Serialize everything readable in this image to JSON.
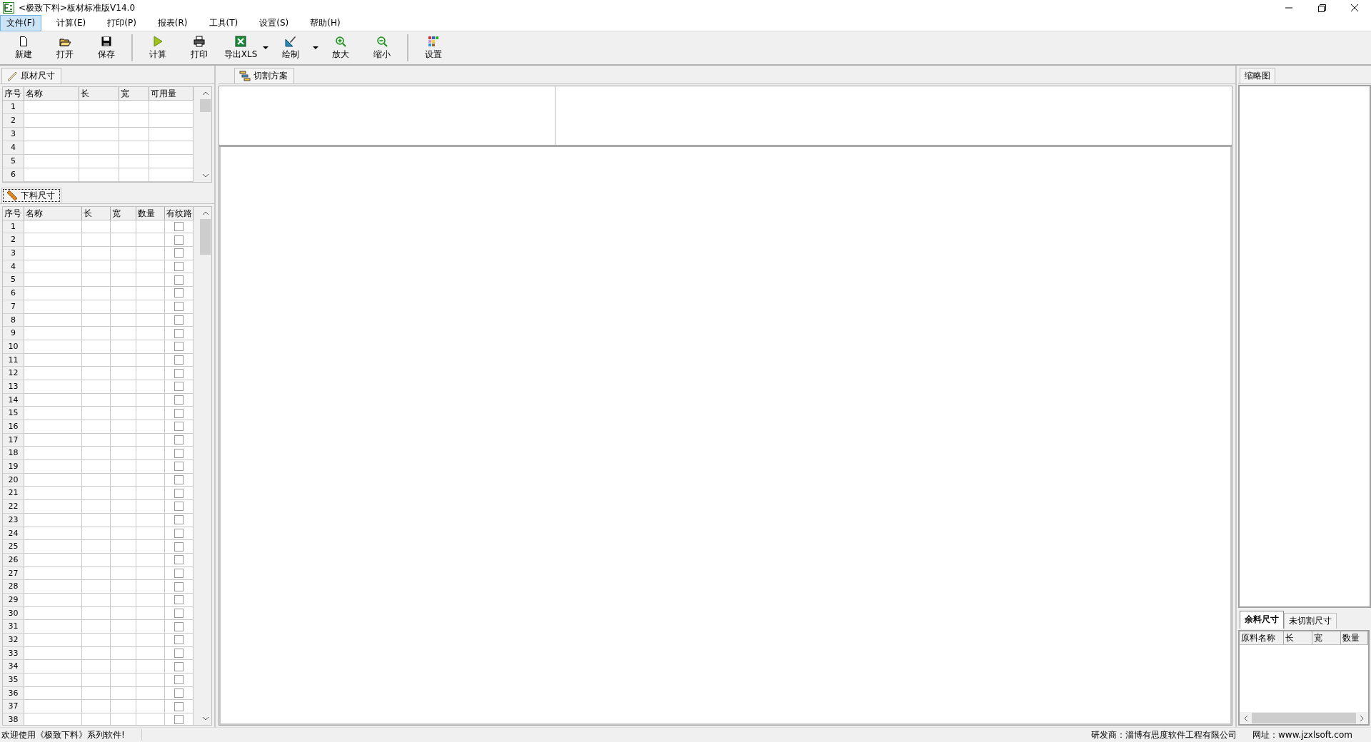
{
  "window": {
    "title": "<极致下料>板材标准版V14.0"
  },
  "menu": [
    {
      "label": "文件(F)",
      "selected": true
    },
    {
      "label": "计算(E)",
      "selected": false
    },
    {
      "label": "打印(P)",
      "selected": false
    },
    {
      "label": "报表(R)",
      "selected": false
    },
    {
      "label": "工具(T)",
      "selected": false
    },
    {
      "label": "设置(S)",
      "selected": false
    },
    {
      "label": "帮助(H)",
      "selected": false
    }
  ],
  "toolbar": {
    "groups": [
      [
        {
          "label": "新建",
          "dropdown": false
        },
        {
          "label": "打开",
          "dropdown": false
        },
        {
          "label": "保存",
          "dropdown": false
        }
      ],
      [
        {
          "label": "计算",
          "dropdown": false
        },
        {
          "label": "打印",
          "dropdown": false
        },
        {
          "label": "导出XLS",
          "dropdown": true
        },
        {
          "label": "绘制",
          "dropdown": true
        },
        {
          "label": "放大",
          "dropdown": false
        },
        {
          "label": "缩小",
          "dropdown": false
        }
      ],
      [
        {
          "label": "设置",
          "dropdown": false
        }
      ]
    ]
  },
  "raw_panel": {
    "tab": "原材尺寸",
    "columns": [
      "序号",
      "名称",
      "长",
      "宽",
      "可用量"
    ],
    "rows": [
      {
        "no": "1"
      },
      {
        "no": "2"
      },
      {
        "no": "3"
      },
      {
        "no": "4"
      },
      {
        "no": "5"
      },
      {
        "no": "6"
      }
    ]
  },
  "cut_panel": {
    "tab": "下料尺寸",
    "columns": [
      "序号",
      "名称",
      "长",
      "宽",
      "数量",
      "有纹路"
    ],
    "rows": [
      {
        "no": "1",
        "has_grain": false
      },
      {
        "no": "2",
        "has_grain": false
      },
      {
        "no": "3",
        "has_grain": false
      },
      {
        "no": "4",
        "has_grain": false
      },
      {
        "no": "5",
        "has_grain": false
      },
      {
        "no": "6",
        "has_grain": false
      },
      {
        "no": "7",
        "has_grain": false
      },
      {
        "no": "8",
        "has_grain": false
      },
      {
        "no": "9",
        "has_grain": false
      },
      {
        "no": "10",
        "has_grain": false
      },
      {
        "no": "11",
        "has_grain": false
      },
      {
        "no": "12",
        "has_grain": false
      },
      {
        "no": "13",
        "has_grain": false
      },
      {
        "no": "14",
        "has_grain": false
      },
      {
        "no": "15",
        "has_grain": false
      },
      {
        "no": "16",
        "has_grain": false
      },
      {
        "no": "17",
        "has_grain": false
      },
      {
        "no": "18",
        "has_grain": false
      },
      {
        "no": "19",
        "has_grain": false
      },
      {
        "no": "20",
        "has_grain": false
      },
      {
        "no": "21",
        "has_grain": false
      },
      {
        "no": "22",
        "has_grain": false
      },
      {
        "no": "23",
        "has_grain": false
      },
      {
        "no": "24",
        "has_grain": false
      },
      {
        "no": "25",
        "has_grain": false
      },
      {
        "no": "26",
        "has_grain": false
      },
      {
        "no": "27",
        "has_grain": false
      },
      {
        "no": "28",
        "has_grain": false
      },
      {
        "no": "29",
        "has_grain": false
      },
      {
        "no": "30",
        "has_grain": false
      },
      {
        "no": "31",
        "has_grain": false
      },
      {
        "no": "32",
        "has_grain": false
      },
      {
        "no": "33",
        "has_grain": false
      },
      {
        "no": "34",
        "has_grain": false
      },
      {
        "no": "35",
        "has_grain": false
      },
      {
        "no": "36",
        "has_grain": false
      },
      {
        "no": "37",
        "has_grain": false
      },
      {
        "no": "38",
        "has_grain": false
      }
    ]
  },
  "plan_panel": {
    "tab": "切割方案"
  },
  "thumbnail_panel": {
    "tab": "缩略图"
  },
  "remnant_panel": {
    "tabs": [
      {
        "label": "余料尺寸",
        "selected": true
      },
      {
        "label": "未切割尺寸",
        "selected": false
      }
    ],
    "columns": [
      "原料名称",
      "长",
      "宽",
      "数量"
    ]
  },
  "status_bar": {
    "message": "欢迎使用《极致下料》系列软件!",
    "developer": "研发商：淄博有思度软件工程有限公司",
    "website": "网址：www.jzxlsoft.com"
  }
}
